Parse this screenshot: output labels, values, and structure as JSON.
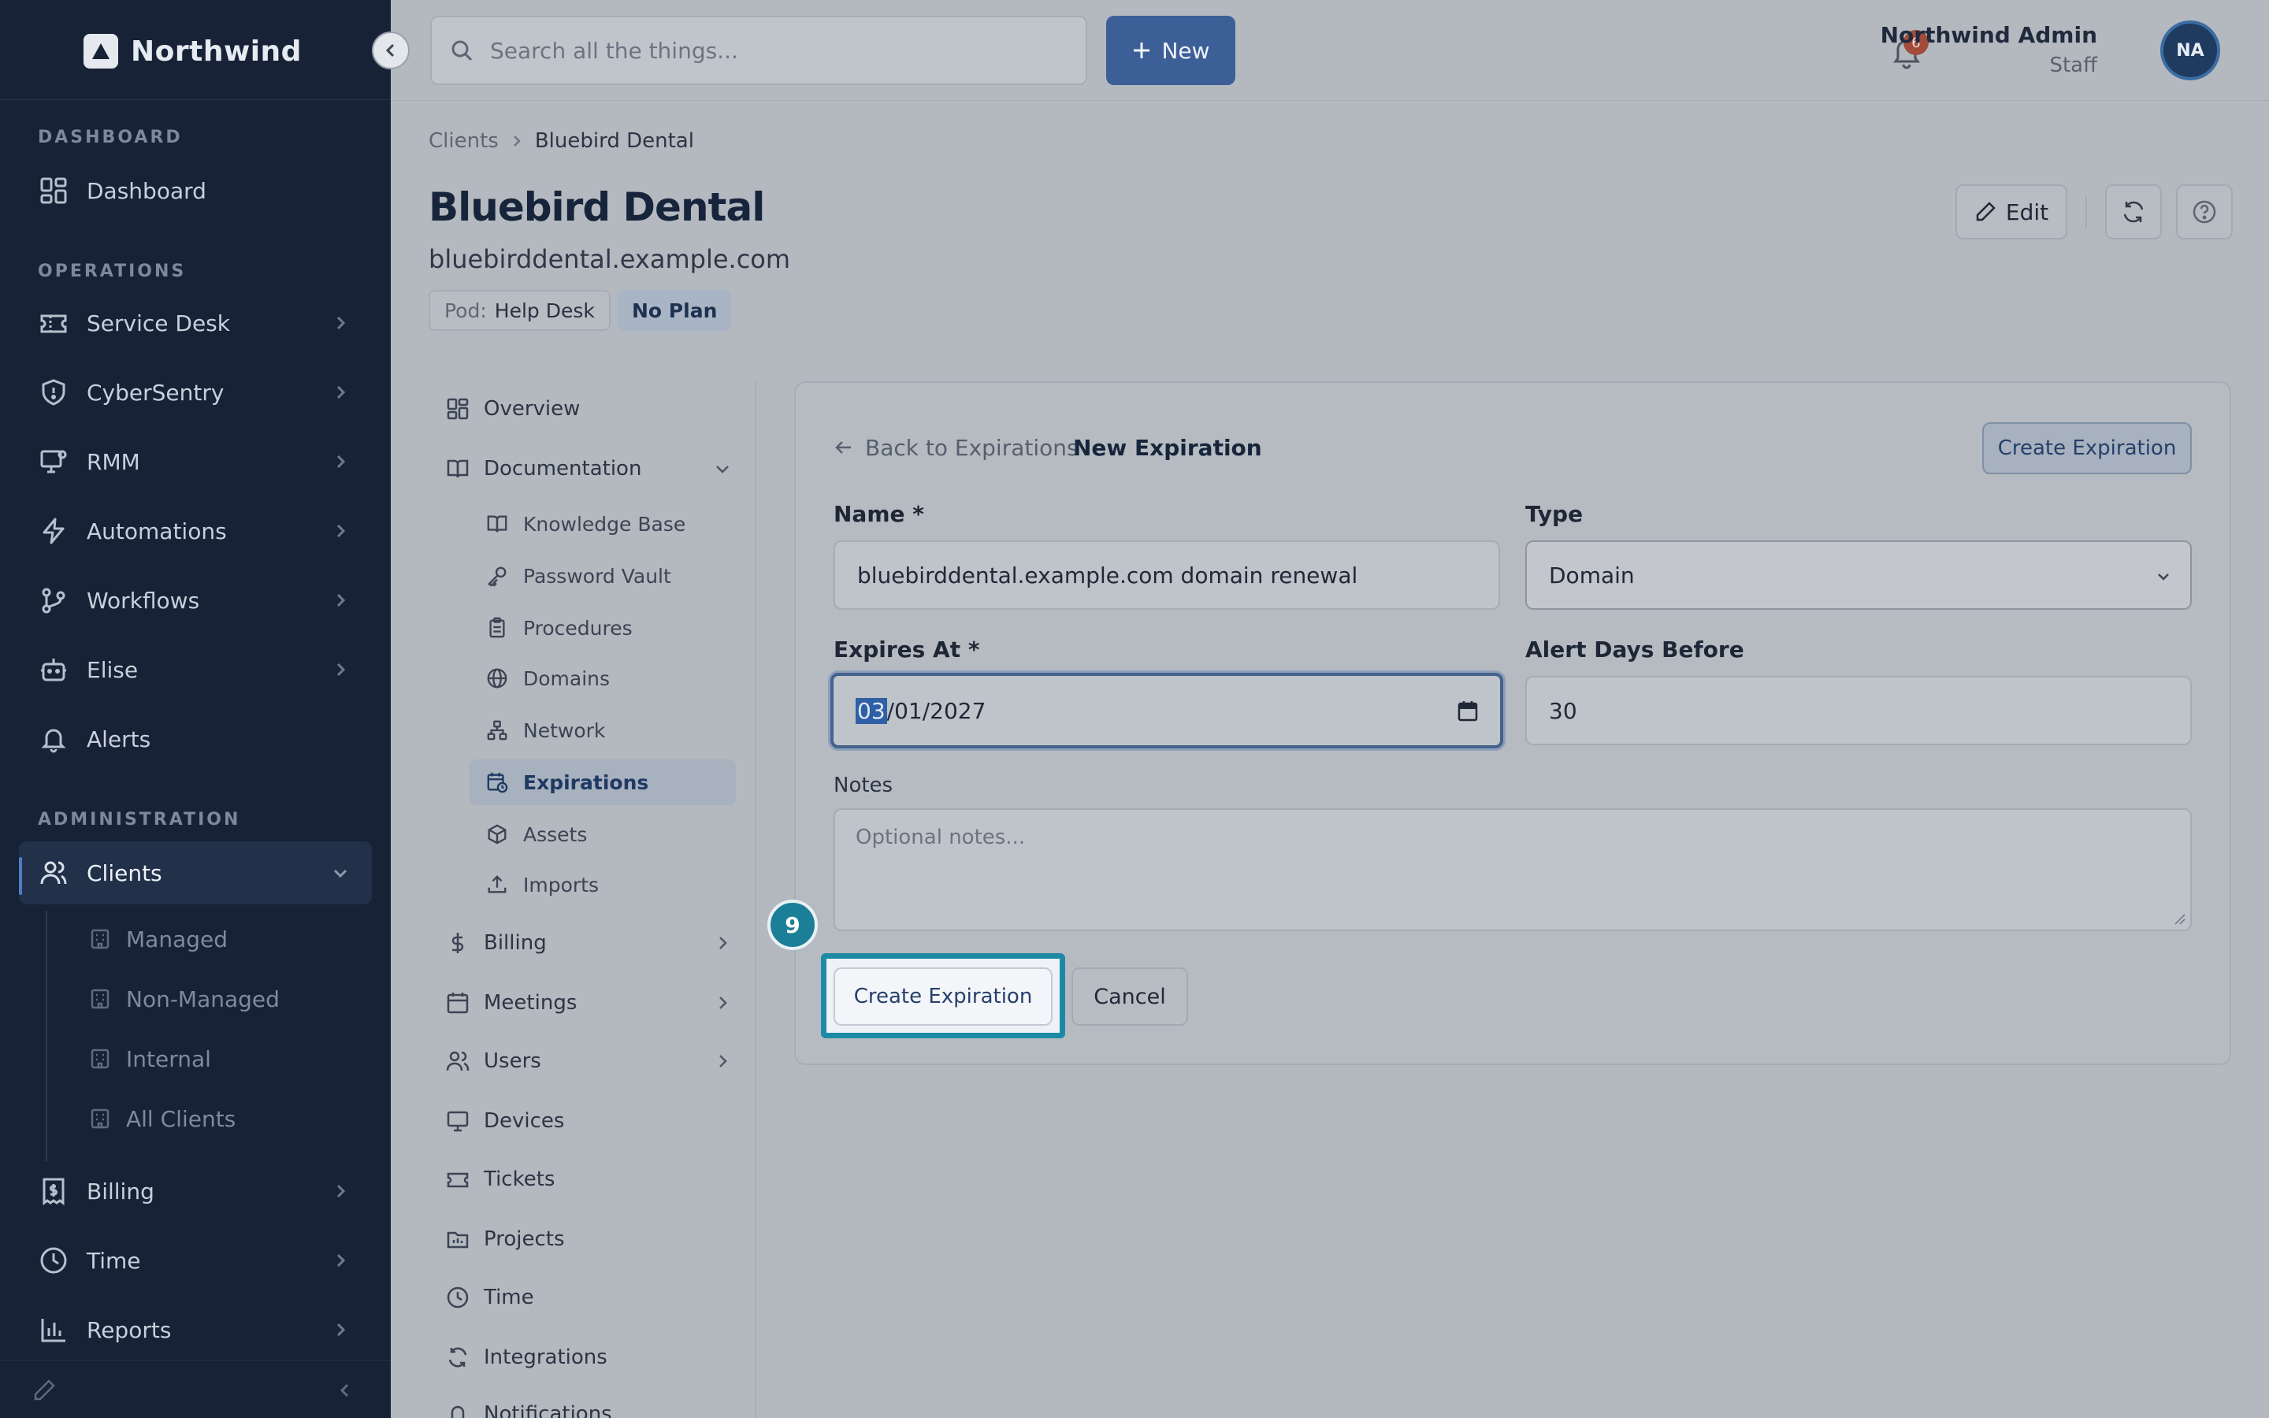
{
  "app": {
    "name": "Northwind"
  },
  "sidebar": {
    "sections": {
      "dashboard": "DASHBOARD",
      "operations": "OPERATIONS",
      "administration": "ADMINISTRATION"
    },
    "items": {
      "dashboard": "Dashboard",
      "service_desk": "Service Desk",
      "cybersentry": "CyberSentry",
      "rmm": "RMM",
      "automations": "Automations",
      "workflows": "Workflows",
      "elise": "Elise",
      "alerts": "Alerts",
      "clients": "Clients",
      "billing": "Billing",
      "time": "Time",
      "reports": "Reports"
    },
    "client_subitems": [
      "Managed",
      "Non-Managed",
      "Internal",
      "All Clients"
    ]
  },
  "topbar": {
    "search_placeholder": "Search all the things...",
    "new_label": "New",
    "notification_count": "6",
    "user_name": "Northwind Admin",
    "user_role": "Staff",
    "avatar_initials": "NA"
  },
  "header": {
    "breadcrumb_root": "Clients",
    "breadcrumb_current": "Bluebird Dental",
    "title": "Bluebird Dental",
    "subtitle": "bluebirddental.example.com",
    "pod_key": "Pod:",
    "pod_value": "Help Desk",
    "plan": "No Plan",
    "edit_label": "Edit"
  },
  "subnav": {
    "overview": "Overview",
    "documentation": "Documentation",
    "knowledge_base": "Knowledge Base",
    "password_vault": "Password Vault",
    "procedures": "Procedures",
    "domains": "Domains",
    "network": "Network",
    "expirations": "Expirations",
    "assets": "Assets",
    "imports": "Imports",
    "billing": "Billing",
    "meetings": "Meetings",
    "users": "Users",
    "devices": "Devices",
    "tickets": "Tickets",
    "projects": "Projects",
    "time": "Time",
    "integrations": "Integrations",
    "notifications": "Notifications"
  },
  "form": {
    "back_label": "Back to Expirations",
    "title": "New Expiration",
    "create_top_label": "Create Expiration",
    "name_label": "Name *",
    "name_value": "bluebirddental.example.com domain renewal",
    "type_label": "Type",
    "type_value": "Domain",
    "expires_label": "Expires At *",
    "expires_month": "03",
    "expires_rest": "/01/2027",
    "alert_label": "Alert Days Before",
    "alert_value": "30",
    "notes_label": "Notes",
    "notes_placeholder": "Optional notes...",
    "create_label": "Create Expiration",
    "cancel_label": "Cancel",
    "step_number": "9"
  },
  "colors": {
    "sidebar_bg": "#172236",
    "primary": "#3d5f97",
    "focus": "#1d8aa5",
    "badge": "#a24b3c"
  }
}
